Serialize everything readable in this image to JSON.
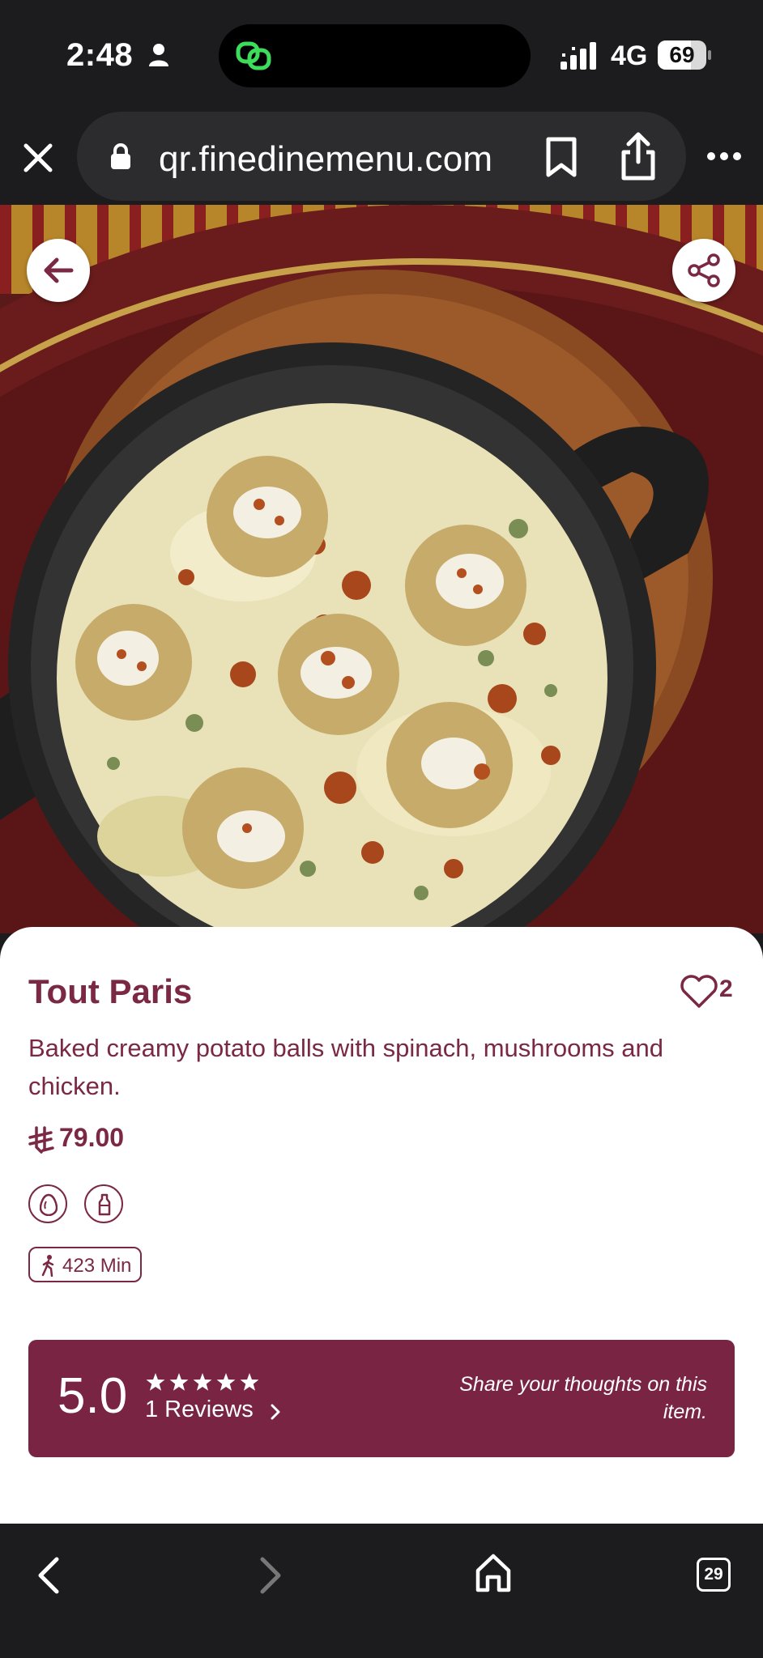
{
  "status_bar": {
    "time": "2:48",
    "network": "4G",
    "battery_level": 69,
    "battery_text": "69"
  },
  "browser": {
    "url": "qr.finedinemenu.com",
    "tab_count": "29",
    "icons": [
      "close-icon",
      "lock-icon",
      "bookmark-icon",
      "share-icon",
      "more-icon",
      "back-icon",
      "forward-icon",
      "home-icon",
      "tabs-icon"
    ]
  },
  "item": {
    "title": "Tout Paris",
    "likes": "2",
    "description": "Baked creamy potato balls with spinach, mushrooms and chicken.",
    "price": "79.00",
    "currency_icon": "saudi-riyal-icon",
    "allergens": [
      "egg-icon",
      "milk-bottle-icon"
    ],
    "prep_time": "423 Min"
  },
  "reviews": {
    "score": "5.0",
    "stars": 5,
    "count_label": "1 Reviews",
    "cta": "Share your thoughts on this item."
  },
  "colors": {
    "brand": "#7a2844",
    "review_banner": "#7a2444",
    "toolbar": "#1c1c1e"
  }
}
